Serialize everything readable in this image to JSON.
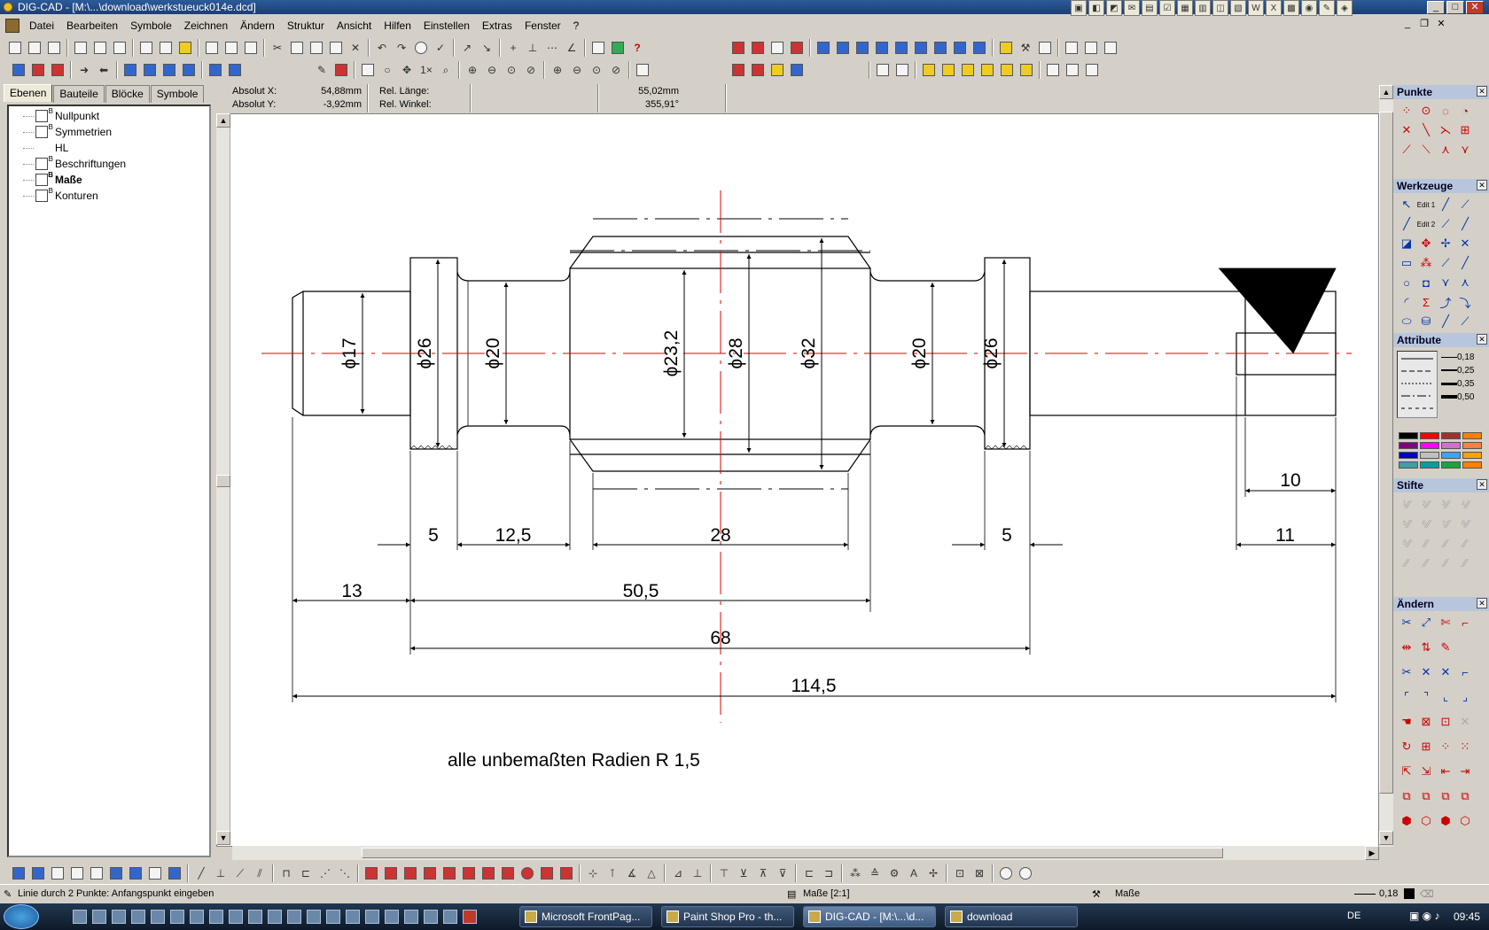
{
  "window": {
    "title": "DIG-CAD - [M:\\...\\download\\werkstueuck014e.dcd]"
  },
  "menu": [
    "Datei",
    "Bearbeiten",
    "Symbole",
    "Zeichnen",
    "Ändern",
    "Struktur",
    "Ansicht",
    "Hilfen",
    "Einstellen",
    "Extras",
    "Fenster",
    "?"
  ],
  "left_tabs": [
    "Ebenen",
    "Bauteile",
    "Blöcke",
    "Symbole"
  ],
  "layers": [
    {
      "label": "Nullpunkt",
      "icon": true,
      "bold": false
    },
    {
      "label": "Symmetrien",
      "icon": true,
      "bold": false
    },
    {
      "label": "HL",
      "icon": false,
      "bold": false
    },
    {
      "label": "Beschriftungen",
      "icon": true,
      "bold": false
    },
    {
      "label": "Maße",
      "icon": true,
      "bold": true
    },
    {
      "label": "Konturen",
      "icon": true,
      "bold": false
    }
  ],
  "coords": {
    "absx_label": "Absolut X:",
    "absx_value": "54,88mm",
    "absy_label": "Absolut Y:",
    "absy_value": "-3,92mm",
    "rellen_label": "Rel. Länge:",
    "rellen_value": "55,02mm",
    "relang_label": "Rel. Winkel:",
    "relang_value": "355,91°"
  },
  "drawing": {
    "diameters": [
      "ϕ17",
      "ϕ26",
      "ϕ20",
      "ϕ23,2",
      "ϕ28",
      "ϕ32",
      "ϕ20",
      "ϕ26"
    ],
    "dims": [
      "5",
      "12,5",
      "28",
      "5",
      "11",
      "10",
      "13",
      "50,5",
      "68",
      "114,5"
    ],
    "note": "alle unbemaßten Radien R 1,5",
    "colors": {
      "centerline": "#e00000",
      "geometry": "#000000"
    }
  },
  "right_panel": {
    "punkte": "Punkte",
    "werkzeuge": "Werkzeuge",
    "attribute": "Attribute",
    "stifte": "Stifte",
    "aendern": "Ändern",
    "line_widths": [
      "0,18",
      "0,25",
      "0,35",
      "0,50"
    ],
    "edit_labels": [
      "Edit 1",
      "Edit 2"
    ],
    "colors": [
      "#000000",
      "#ff0000",
      "#a03030",
      "#ff8000",
      "#800080",
      "#ff00ff",
      "#d070d0",
      "#ff8040",
      "#0000c0",
      "#c0c0c0",
      "#40a0ff",
      "#ffa000",
      "#40a0a0",
      "#00a0a0",
      "#20a040",
      "#ff8000"
    ]
  },
  "status": {
    "hint": "Linie durch 2 Punkte: Anfangspunkt eingeben",
    "layer": "Maße [2:1]",
    "layer2": "Maße",
    "linewidth": "0,18"
  },
  "taskbar": {
    "tasks": [
      "Microsoft FrontPag...",
      "Paint Shop Pro - th...",
      "DIG-CAD - [M:\\...\\d...",
      "download"
    ],
    "lang": "DE",
    "clock": "09:45"
  }
}
